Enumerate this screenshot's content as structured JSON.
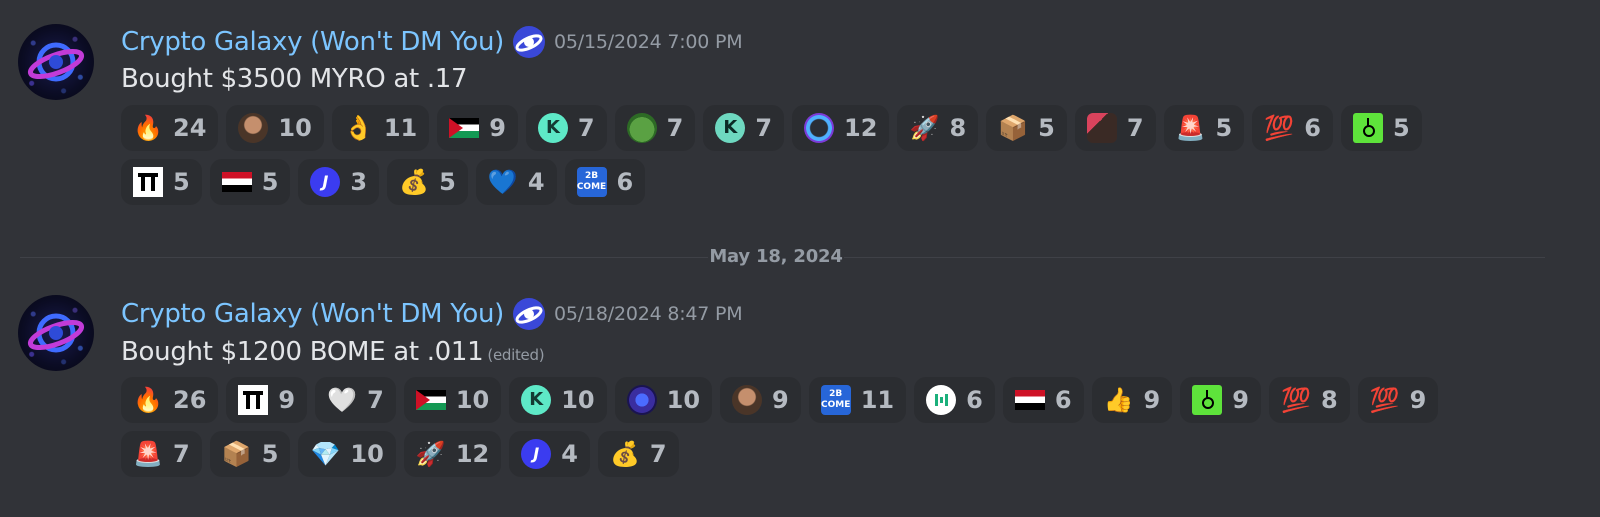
{
  "messages": [
    {
      "username": "Crypto Galaxy (Won't DM You)",
      "timestamp": "05/15/2024 7:00 PM",
      "content": "Bought $3500 MYRO at .17",
      "edited": "",
      "reaction_rows": [
        [
          {
            "icon": "fire-emoji",
            "glyph": "🔥",
            "count": "24"
          },
          {
            "icon": "custom-face-emoji",
            "glyph": "",
            "count": "10"
          },
          {
            "icon": "ok-hand-emoji",
            "glyph": "👌",
            "count": "11"
          },
          {
            "icon": "palestine-flag-emoji",
            "glyph": "",
            "count": "9"
          },
          {
            "icon": "custom-teal-k-emoji",
            "glyph": "",
            "count": "7"
          },
          {
            "icon": "pepe-emoji",
            "glyph": "",
            "count": "7"
          },
          {
            "icon": "custom-teal-k-emoji-2",
            "glyph": "",
            "count": "7"
          },
          {
            "icon": "custom-dog-coin-emoji",
            "glyph": "",
            "count": "12"
          },
          {
            "icon": "rocket-emoji",
            "glyph": "🚀",
            "count": "8"
          },
          {
            "icon": "package-emoji",
            "glyph": "📦",
            "count": "5"
          },
          {
            "icon": "custom-face2-emoji",
            "glyph": "",
            "count": "7"
          },
          {
            "icon": "siren-emoji",
            "glyph": "🚨",
            "count": "5"
          },
          {
            "icon": "hundred-points-emoji",
            "glyph": "💯",
            "count": "6"
          },
          {
            "icon": "custom-green-square-emoji",
            "glyph": "",
            "count": "5"
          }
        ],
        [
          {
            "icon": "custom-white-square-emoji",
            "glyph": "",
            "count": "5"
          },
          {
            "icon": "yemen-flag-emoji",
            "glyph": "",
            "count": "5"
          },
          {
            "icon": "custom-blue-j-emoji",
            "glyph": "",
            "count": "3"
          },
          {
            "icon": "money-bag-emoji",
            "glyph": "💰",
            "count": "5"
          },
          {
            "icon": "blue-heart-emoji",
            "glyph": "💙",
            "count": "4"
          },
          {
            "icon": "custom-bome-emoji",
            "glyph": "",
            "count": "6"
          }
        ]
      ]
    },
    {
      "username": "Crypto Galaxy (Won't DM You)",
      "timestamp": "05/18/2024 8:47 PM",
      "content": "Bought $1200 BOME at .011",
      "edited": "(edited)",
      "reaction_rows": [
        [
          {
            "icon": "fire-emoji",
            "glyph": "🔥",
            "count": "26"
          },
          {
            "icon": "custom-white-square-emoji",
            "glyph": "",
            "count": "9"
          },
          {
            "icon": "white-heart-emoji",
            "glyph": "🤍",
            "count": "7"
          },
          {
            "icon": "palestine-flag-emoji",
            "glyph": "",
            "count": "10"
          },
          {
            "icon": "custom-teal-k-emoji",
            "glyph": "",
            "count": "10"
          },
          {
            "icon": "custom-galaxy-emoji",
            "glyph": "",
            "count": "10"
          },
          {
            "icon": "custom-face-emoji",
            "glyph": "",
            "count": "9"
          },
          {
            "icon": "custom-bome-emoji",
            "glyph": "",
            "count": "11"
          },
          {
            "icon": "custom-green-bars-emoji",
            "glyph": "",
            "count": "6"
          },
          {
            "icon": "yemen-flag-emoji",
            "glyph": "",
            "count": "6"
          },
          {
            "icon": "thumbs-up-emoji",
            "glyph": "👍",
            "count": "9"
          },
          {
            "icon": "custom-green-square-emoji",
            "glyph": "",
            "count": "9"
          },
          {
            "icon": "hundred-points-emoji",
            "glyph": "💯",
            "count": "8"
          },
          {
            "icon": "thousand-points-emoji",
            "glyph": "💯",
            "count": "9"
          }
        ],
        [
          {
            "icon": "siren-emoji",
            "glyph": "🚨",
            "count": "7"
          },
          {
            "icon": "package-emoji",
            "glyph": "📦",
            "count": "5"
          },
          {
            "icon": "gem-emoji",
            "glyph": "💎",
            "count": "10"
          },
          {
            "icon": "rocket-emoji",
            "glyph": "🚀",
            "count": "12"
          },
          {
            "icon": "custom-blue-j-emoji",
            "glyph": "",
            "count": "4"
          },
          {
            "icon": "money-bag-emoji",
            "glyph": "💰",
            "count": "7"
          }
        ]
      ]
    }
  ],
  "date_divider": "May 18, 2024",
  "colors": {
    "background": "#313338",
    "username": "#7cc5ff",
    "reaction_bg": "#2b2d31"
  }
}
